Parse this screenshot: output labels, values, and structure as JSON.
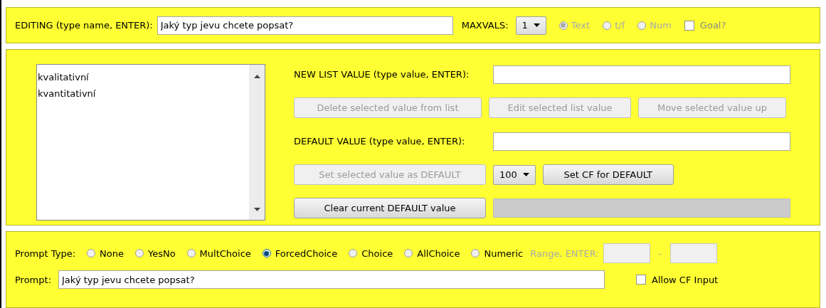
{
  "editing": {
    "label": "EDITING (type name, ENTER):",
    "value": "Jaký typ jevu chcete popsat?"
  },
  "maxvals": {
    "label": "MAXVALS:",
    "value": "1"
  },
  "types": [
    {
      "label": "Text",
      "selected": true,
      "disabled": true
    },
    {
      "label": "t/f",
      "selected": false,
      "disabled": true
    },
    {
      "label": "Num",
      "selected": false,
      "disabled": true
    }
  ],
  "goal": {
    "label": "Goal?",
    "checked": false
  },
  "values_list": [
    {
      "label": "kvalitativní"
    },
    {
      "label": "kvantitativní"
    }
  ],
  "new_value": {
    "label": "NEW LIST VALUE (type value, ENTER):"
  },
  "list_buttons": [
    {
      "label": "Delete selected value from list",
      "disabled": true
    },
    {
      "label": "Edit selected list value",
      "disabled": true
    },
    {
      "label": "Move selected value up",
      "disabled": true
    }
  ],
  "default_value": {
    "label": "DEFAULT VALUE (type value, ENTER):"
  },
  "set_default": {
    "label": "Set selected value as DEFAULT",
    "disabled": true
  },
  "cf": {
    "value": "100"
  },
  "set_cf": {
    "label": "Set CF for DEFAULT",
    "disabled": false
  },
  "clear_default": {
    "label": "Clear current DEFAULT value",
    "disabled": false
  },
  "prompt_type": {
    "label": "Prompt Type:",
    "options": [
      {
        "label": "None",
        "selected": false
      },
      {
        "label": "YesNo",
        "selected": false
      },
      {
        "label": "MultChoice",
        "selected": false
      },
      {
        "label": "ForcedChoice",
        "selected": true
      },
      {
        "label": "Choice",
        "selected": false
      },
      {
        "label": "AllChoice",
        "selected": false
      },
      {
        "label": "Numeric",
        "selected": false
      }
    ]
  },
  "range": {
    "label": "Range, ENTER:",
    "separator": "-"
  },
  "prompt": {
    "label": "Prompt:",
    "value": "Jaký typ jevu chcete popsat?"
  },
  "allow_cf": {
    "label": "Allow CF Input",
    "checked": false
  }
}
